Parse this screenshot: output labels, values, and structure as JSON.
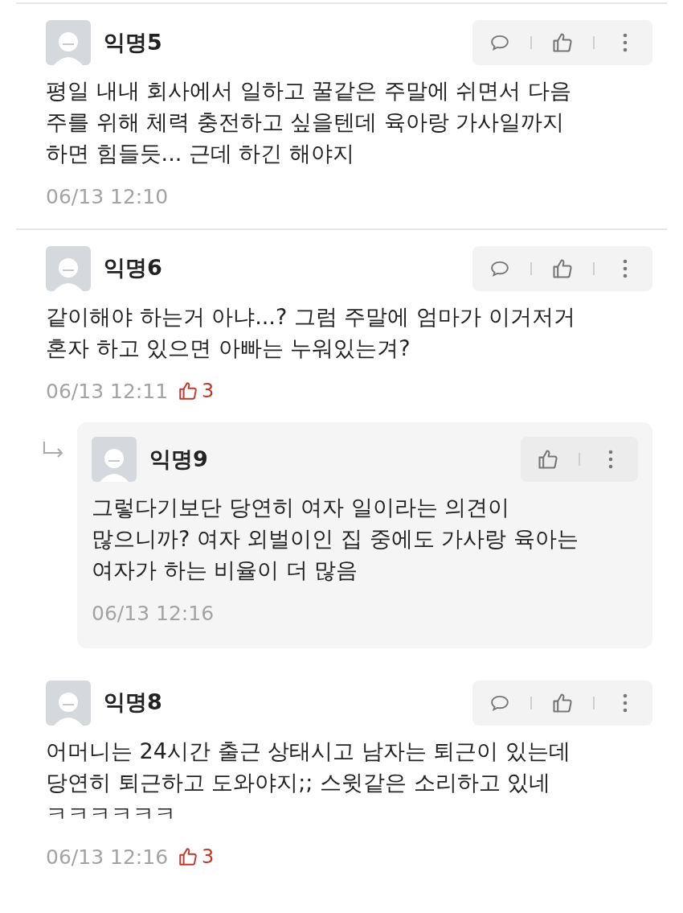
{
  "comments": [
    {
      "kind": "comment",
      "author": "익명5",
      "body": "평일 내내 회사에서 일하고 꿀같은 주말에 쉬면서 다음 주를 위해 체력 충전하고 싶을텐데 육아랑 가사일까지 하면 힘들듯... 근데 하긴 해야지",
      "time": "06/13 12:10"
    },
    {
      "kind": "comment",
      "author": "익명6",
      "body": "같이해야 하는거 아냐...? 그럼 주말에 엄마가 이거저거 혼자 하고 있으면 아빠는 누워있는겨?",
      "time": "06/13 12:11",
      "likes": "3"
    },
    {
      "kind": "reply",
      "author": "익명9",
      "body": "그렇다기보단 당연히 여자 일이라는 의견이 많으니까? 여자 외벌이인 집 중에도 가사랑 육아는 여자가 하는 비율이 더 많음",
      "time": "06/13 12:16"
    },
    {
      "kind": "comment",
      "author": "익명8",
      "body": "어머니는 24시간 출근 상태시고 남자는 퇴근이 있는데 당연히 퇴근하고 도와야지;; 스윗같은 소리하고 있네 ㅋㅋㅋㅋㅋㅋ",
      "time": "06/13 12:16",
      "likes": "3"
    }
  ]
}
